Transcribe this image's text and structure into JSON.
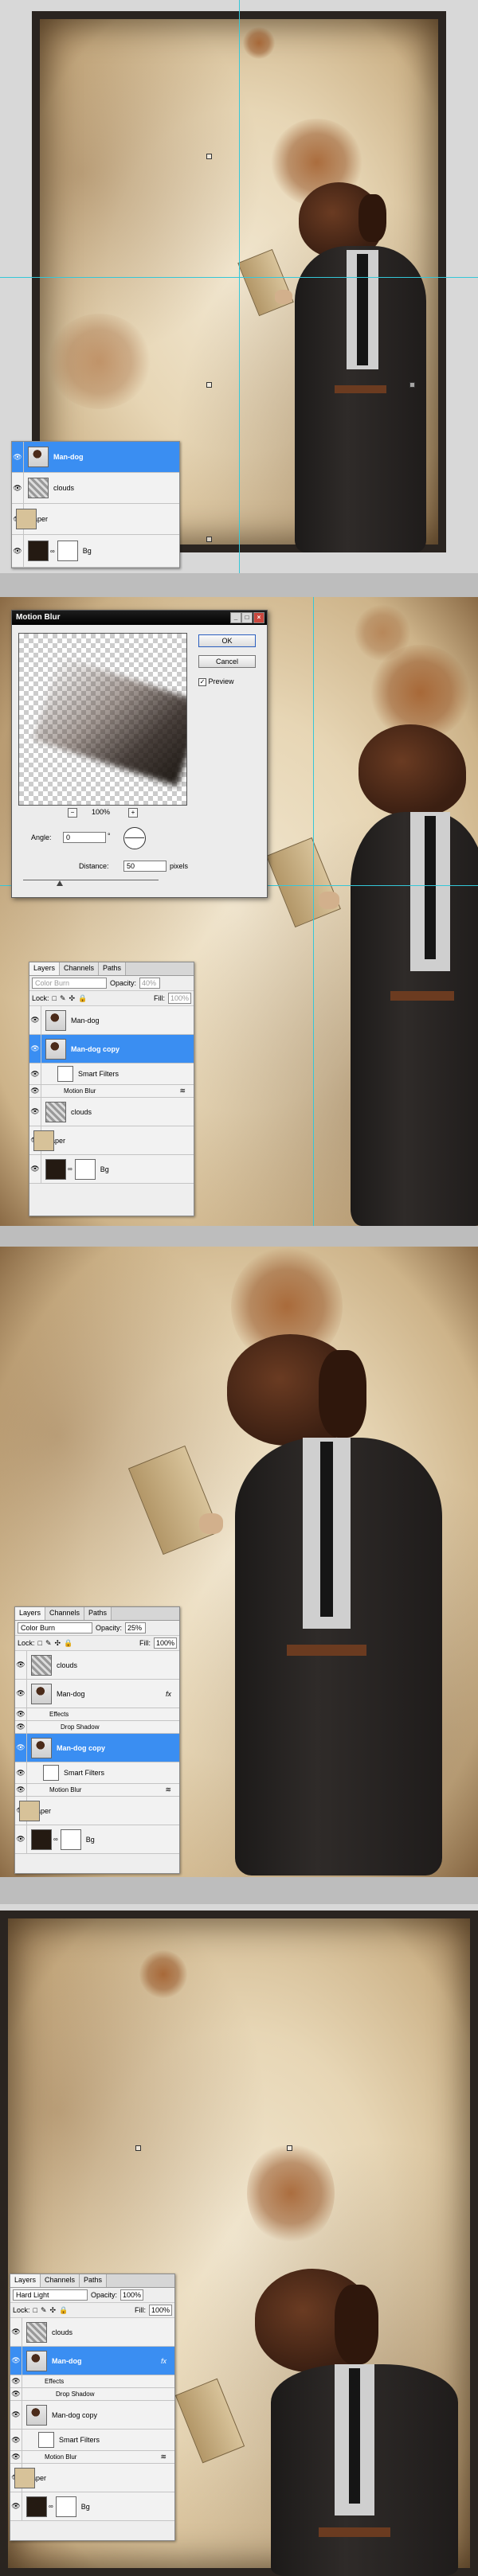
{
  "panels": [
    {
      "id": "panel1",
      "layers": {
        "rows": [
          {
            "name": "Man-dog",
            "selected": true
          },
          {
            "name": "clouds",
            "selected": false
          },
          {
            "name": "Paper",
            "selected": false
          },
          {
            "name": "Bg",
            "selected": false
          }
        ]
      }
    },
    {
      "id": "panel2",
      "dialog": {
        "title": "Motion Blur",
        "ok": "OK",
        "cancel": "Cancel",
        "preview_label": "Preview",
        "preview_checked": true,
        "zoom": "100%",
        "zoom_minus": "−",
        "zoom_plus": "+",
        "angle_label": "Angle:",
        "angle_value": "0",
        "angle_unit": "°",
        "distance_label": "Distance:",
        "distance_value": "50",
        "distance_unit": "pixels"
      },
      "layers": {
        "tabs": [
          "Layers",
          "Channels",
          "Paths"
        ],
        "blend_mode": "Color Burn",
        "opacity_label": "Opacity:",
        "opacity": "40%",
        "lock_label": "Lock:",
        "fill_label": "Fill:",
        "fill": "100%",
        "rows": [
          {
            "name": "Man-dog"
          },
          {
            "name": "Man-dog copy",
            "selected": true
          },
          {
            "name": "Smart Filters"
          },
          {
            "name": "Motion Blur"
          },
          {
            "name": "clouds"
          },
          {
            "name": "Paper"
          },
          {
            "name": "Bg"
          }
        ]
      }
    },
    {
      "id": "panel3",
      "layers": {
        "tabs": [
          "Layers",
          "Channels",
          "Paths"
        ],
        "blend_mode": "Color Burn",
        "opacity_label": "Opacity:",
        "opacity": "25%",
        "lock_label": "Lock:",
        "fill_label": "Fill:",
        "fill": "100%",
        "rows": [
          {
            "name": "clouds"
          },
          {
            "name": "Man-dog",
            "fx": "fx"
          },
          {
            "name": "Effects"
          },
          {
            "name": "Drop Shadow"
          },
          {
            "name": "Man-dog copy",
            "selected": true
          },
          {
            "name": "Smart Filters"
          },
          {
            "name": "Motion Blur"
          },
          {
            "name": "Paper"
          },
          {
            "name": "Bg"
          }
        ]
      }
    },
    {
      "id": "panel4",
      "layers": {
        "tabs": [
          "Layers",
          "Channels",
          "Paths"
        ],
        "blend_mode": "Hard Light",
        "opacity_label": "Opacity:",
        "opacity": "100%",
        "lock_label": "Lock:",
        "fill_label": "Fill:",
        "fill": "100%",
        "rows": [
          {
            "name": "clouds"
          },
          {
            "name": "Man-dog",
            "fx": "fx",
            "selected": true
          },
          {
            "name": "Effects"
          },
          {
            "name": "Drop Shadow"
          },
          {
            "name": "Man-dog copy"
          },
          {
            "name": "Smart Filters"
          },
          {
            "name": "Motion Blur"
          },
          {
            "name": "Paper"
          },
          {
            "name": "Bg"
          }
        ]
      }
    }
  ],
  "icons": {
    "eye": "eye-icon",
    "chain": "link-icon",
    "smart_object": "smart-object-icon",
    "filter": "filter-icon",
    "effects": "effects-icon"
  },
  "colors": {
    "selection": "#3a8ef2",
    "guide": "#35c7d8",
    "paper": "#e7d6b5",
    "dialog_title": "#000000"
  }
}
